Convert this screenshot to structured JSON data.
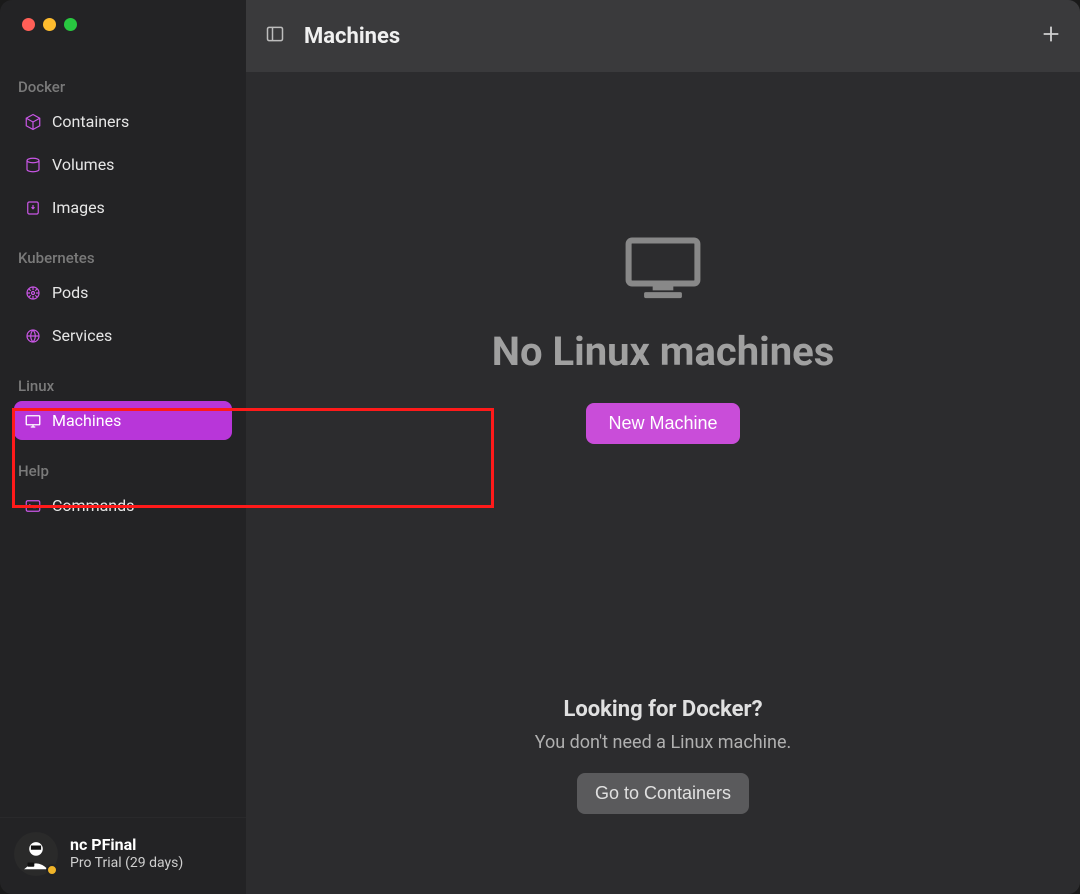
{
  "header": {
    "title": "Machines"
  },
  "sidebar": {
    "sections": {
      "docker": {
        "label": "Docker",
        "items": {
          "containers": "Containers",
          "volumes": "Volumes",
          "images": "Images"
        }
      },
      "kubernetes": {
        "label": "Kubernetes",
        "items": {
          "pods": "Pods",
          "services": "Services"
        }
      },
      "linux": {
        "label": "Linux",
        "items": {
          "machines": "Machines"
        }
      },
      "help": {
        "label": "Help",
        "items": {
          "commands": "Commands"
        }
      }
    }
  },
  "user": {
    "name": "nc PFinal",
    "plan": "Pro Trial (29 days)"
  },
  "main": {
    "empty_title": "No Linux machines",
    "new_machine": "New Machine",
    "docker_hint_title": "Looking for Docker?",
    "docker_hint_sub": "You don't need a Linux machine.",
    "go_containers": "Go to Containers"
  },
  "colors": {
    "accent": "#b836d9",
    "button": "#c94dd9"
  }
}
